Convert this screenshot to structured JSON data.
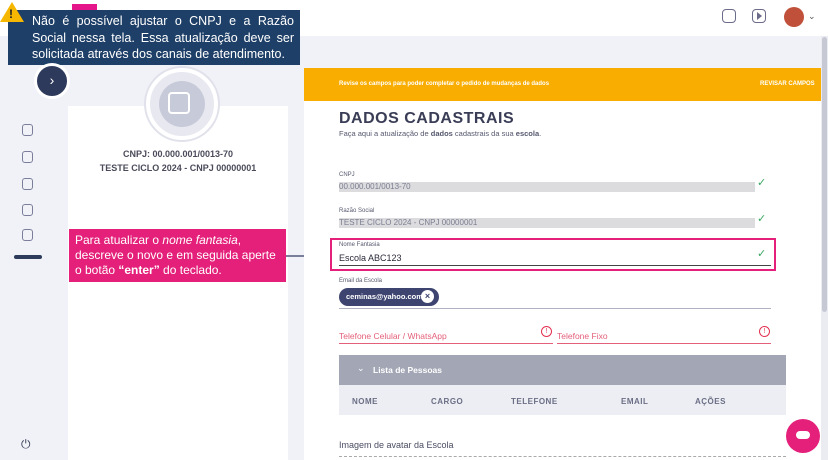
{
  "warning": {
    "text": "Não é possível ajustar o CNPJ e a Razão Social nessa tela. Essa atualização deve ser solicitada através dos canais de atendimento."
  },
  "profile": {
    "cnpj": "CNPJ: 00.000.001/0013-70",
    "name": "TESTE CICLO 2024 - CNPJ 00000001"
  },
  "callout": {
    "text_before": "Para atualizar o ",
    "text_em": "nome fantasia",
    "text_middle": ", descreve o novo e em seguida aperte o botão ",
    "text_bold": "“enter”",
    "text_after": " do teclado."
  },
  "alert": {
    "text": "Revise os campos para poder completar o pedido de mudanças de dados",
    "button": "REVISAR CAMPOS"
  },
  "page": {
    "title": "DADOS CADASTRAIS",
    "subtitle_before": "Faça aqui a atualização de ",
    "subtitle_bold1": "dados",
    "subtitle_middle": " cadastrais da sua ",
    "subtitle_bold2": "escola",
    "subtitle_after": "."
  },
  "fields": {
    "cnpj": {
      "label": "CNPJ",
      "value": "00.000.001/0013-70"
    },
    "razao": {
      "label": "Razão Social",
      "value": "TESTE CICLO 2024 - CNPJ 00000001"
    },
    "fantasia": {
      "label": "Nome Fantasia",
      "value": "Escola ABC123"
    },
    "email": {
      "label": "Email da Escola",
      "chip": "ceminas@yahoo.com"
    },
    "celular": {
      "placeholder": "Telefone Celular / WhatsApp"
    },
    "fixo": {
      "placeholder": "Telefone Fixo"
    }
  },
  "people": {
    "title": "Lista de Pessoas",
    "columns": [
      "NOME",
      "CARGO",
      "TELEFONE",
      "EMAIL",
      "AÇÕES"
    ]
  },
  "avatar_section": {
    "label": "Imagem de avatar da Escola"
  },
  "colors": {
    "accent_pink": "#e4207a",
    "alert_orange": "#f9ad00",
    "navy": "#1e3f67",
    "success_green": "#3aa860"
  }
}
